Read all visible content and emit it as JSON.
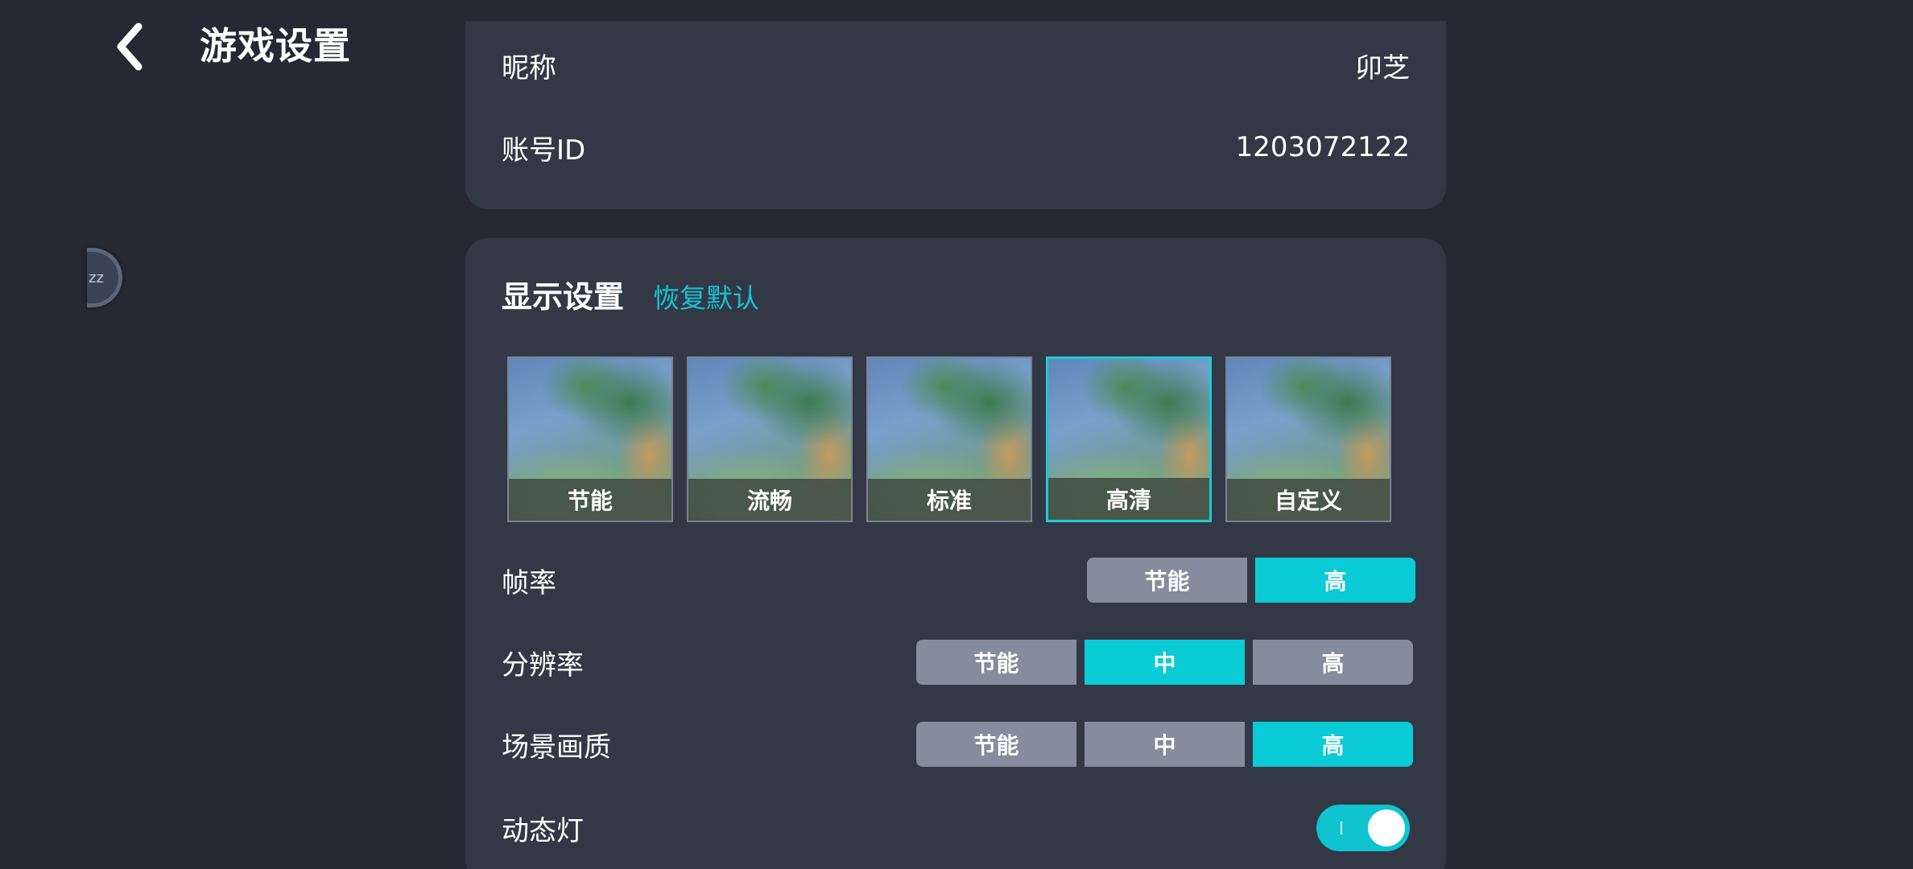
{
  "header": {
    "title": "游戏设置",
    "back_icon": "chevron-left-icon"
  },
  "float_ball": {
    "text": "zz"
  },
  "account": {
    "nickname_label": "昵称",
    "nickname_value": "卯芝",
    "account_id_label": "账号ID",
    "account_id_value": "1203072122"
  },
  "display": {
    "title": "显示设置",
    "reset_label": "恢复默认",
    "presets": [
      {
        "label": "节能",
        "selected": false
      },
      {
        "label": "流畅",
        "selected": false
      },
      {
        "label": "标准",
        "selected": false
      },
      {
        "label": "高清",
        "selected": true
      },
      {
        "label": "自定义",
        "selected": false
      }
    ],
    "frame_rate": {
      "label": "帧率",
      "options": [
        "节能",
        "高"
      ],
      "selected": "高"
    },
    "resolution": {
      "label": "分辨率",
      "options": [
        "节能",
        "中",
        "高"
      ],
      "selected": "中"
    },
    "scene_quality": {
      "label": "场景画质",
      "options": [
        "节能",
        "中",
        "高"
      ],
      "selected": "高"
    },
    "dynamic_light": {
      "label": "动态灯",
      "enabled": true
    }
  },
  "colors": {
    "background": "#262833",
    "card": "#333847",
    "accent": "#0acbd6",
    "inactive_option": "#858c9d"
  }
}
